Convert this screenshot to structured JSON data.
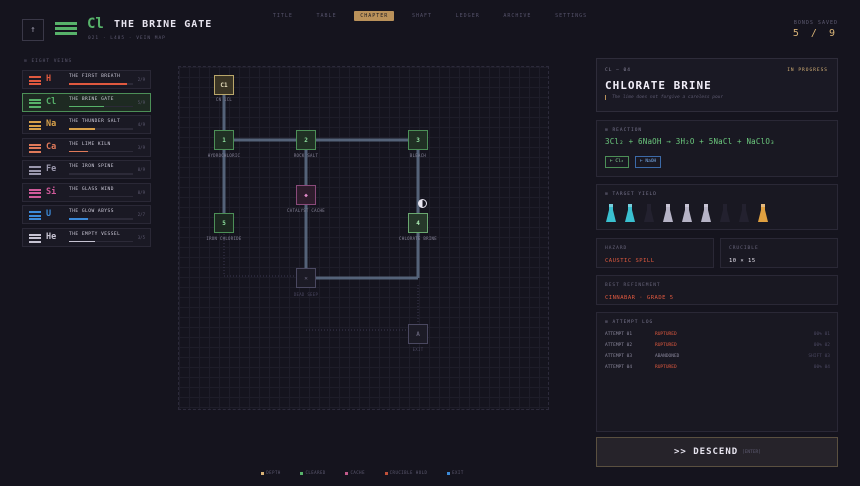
{
  "topnav": {
    "tabs": [
      {
        "label": "TITLE",
        "active": false
      },
      {
        "label": "TABLE",
        "active": false
      },
      {
        "label": "CHAPTER",
        "active": true
      },
      {
        "label": "SHAFT",
        "active": false
      },
      {
        "label": "LEDGER",
        "active": false
      },
      {
        "label": "ARCHIVE",
        "active": false
      },
      {
        "label": "SETTINGS",
        "active": false
      }
    ]
  },
  "header": {
    "back_icon": "arrow-up-icon",
    "symbol": "Cl",
    "title": "THE BRINE GATE",
    "subtitle": "021 · L485 · VEIN MAP",
    "bonds_label": "BONDS SAVED",
    "bonds_value": "5 / 9",
    "accent": "#57b26a"
  },
  "veins": {
    "heading": "EIGHT VEINS",
    "items": [
      {
        "symbol": "H",
        "name": "THE FIRST BREATH",
        "count": "2/9",
        "progress": 0.9,
        "color": "#e0593f",
        "active": false
      },
      {
        "symbol": "Cl",
        "name": "THE BRINE GATE",
        "count": "5/9",
        "progress": 0.55,
        "color": "#57b26a",
        "active": true
      },
      {
        "symbol": "Na",
        "name": "THE THUNDER SALT",
        "count": "4/9",
        "progress": 0.4,
        "color": "#d8a14a",
        "active": false
      },
      {
        "symbol": "Ca",
        "name": "THE LIME KILN",
        "count": "3/9",
        "progress": 0.3,
        "color": "#e07a5a",
        "active": false
      },
      {
        "symbol": "Fe",
        "name": "THE IRON SPINE",
        "count": "0/9",
        "progress": 0.0,
        "color": "#9b98ad",
        "active": false
      },
      {
        "symbol": "Si",
        "name": "THE GLASS WIND",
        "count": "0/9",
        "progress": 0.0,
        "color": "#d05a9a",
        "active": false
      },
      {
        "symbol": "U",
        "name": "THE GLOW ABYSS",
        "count": "2/7",
        "progress": 0.3,
        "color": "#3c8ad8",
        "active": false
      },
      {
        "symbol": "He",
        "name": "THE EMPTY VESSEL",
        "count": "3/5",
        "progress": 0.4,
        "color": "#c6c3d2",
        "active": false
      }
    ]
  },
  "map": {
    "nodes": [
      {
        "id": "cl",
        "label": "C1",
        "caption": "CN 1CL",
        "state": "current"
      },
      {
        "id": "n1",
        "label": "1",
        "caption": "HYDROCHLORIC",
        "state": "cleared"
      },
      {
        "id": "n2",
        "label": "2",
        "caption": "ROCK SALT",
        "state": "cleared"
      },
      {
        "id": "n3",
        "label": "3",
        "caption": "BLEACH",
        "state": "cleared"
      },
      {
        "id": "n5",
        "label": "5",
        "caption": "IRON CHLORIDE",
        "state": "cleared"
      },
      {
        "id": "cat",
        "label": "◆",
        "caption": "CATALYST CACHE",
        "state": "cache"
      },
      {
        "id": "n4",
        "label": "4",
        "caption": "CHLORATE BRINE",
        "state": "cleared"
      },
      {
        "id": "x",
        "label": "✕",
        "caption": "DEAD SEEP",
        "state": "locked"
      },
      {
        "id": "a",
        "label": "A",
        "caption": "EXIT",
        "state": "locked"
      }
    ]
  },
  "legend": [
    {
      "label": "DEPTH",
      "color": "#d8b377"
    },
    {
      "label": "CLEARED",
      "color": "#57b26a"
    },
    {
      "label": "CACHE",
      "color": "#c05a8a"
    },
    {
      "label": "CRUCIBLE HOLD",
      "color": "#c0503a"
    },
    {
      "label": "EXIT",
      "color": "#3c8ad8"
    }
  ],
  "detail": {
    "code": "CL — 04",
    "status": "IN PROGRESS",
    "title": "CHLORATE BRINE",
    "quote": "The lime does not forgive a careless pour"
  },
  "reaction": {
    "heading": "REACTION",
    "equation": "3Cl₂ + 6NaOH → 3H₂O + 5NaCl + NaClO₃",
    "chips": [
      {
        "label": "⊢ Cl₂",
        "color": "#57b26a"
      },
      {
        "label": "⊢ NaOH",
        "color": "#3c8ad8"
      }
    ]
  },
  "yield": {
    "heading": "TARGET YIELD",
    "flasks": [
      {
        "color": "#3ac0d0",
        "filled": true
      },
      {
        "color": "#3ac0d0",
        "filled": true
      },
      {
        "color": "#2a2838",
        "filled": false
      },
      {
        "color": "#b6b3c6",
        "filled": true
      },
      {
        "color": "#b6b3c6",
        "filled": true
      },
      {
        "color": "#b6b3c6",
        "filled": true
      },
      {
        "color": "#2a2838",
        "filled": false
      },
      {
        "color": "#2a2838",
        "filled": false
      },
      {
        "color": "#e0a040",
        "filled": true
      }
    ]
  },
  "hazard": {
    "label": "HAZARD",
    "value": "CAUSTIC SPILL",
    "color": "#e0593f"
  },
  "crucible": {
    "label": "CRUCIBLE",
    "value": "10 × 15",
    "color": "#e8e5f0"
  },
  "refinement": {
    "label": "BEST REFINEMENT",
    "value": "CINNABAR · GRADE 5",
    "color": "#e0593f"
  },
  "log": {
    "heading": "ATTEMPT LOG",
    "rows": [
      {
        "attempt": "ATTEMPT 01",
        "result": "RUPTURED",
        "color": "#e0593f",
        "time": "00% 01"
      },
      {
        "attempt": "ATTEMPT 02",
        "result": "RUPTURED",
        "color": "#e0593f",
        "time": "00% 02"
      },
      {
        "attempt": "ATTEMPT 03",
        "result": "ABANDONED",
        "color": "#8a879c",
        "time": "SHIFT 03"
      },
      {
        "attempt": "ATTEMPT 04",
        "result": "RUPTURED",
        "color": "#e0593f",
        "time": "00% 04"
      }
    ]
  },
  "action": {
    "label": ">> DESCEND",
    "key": "[ENTER]"
  }
}
